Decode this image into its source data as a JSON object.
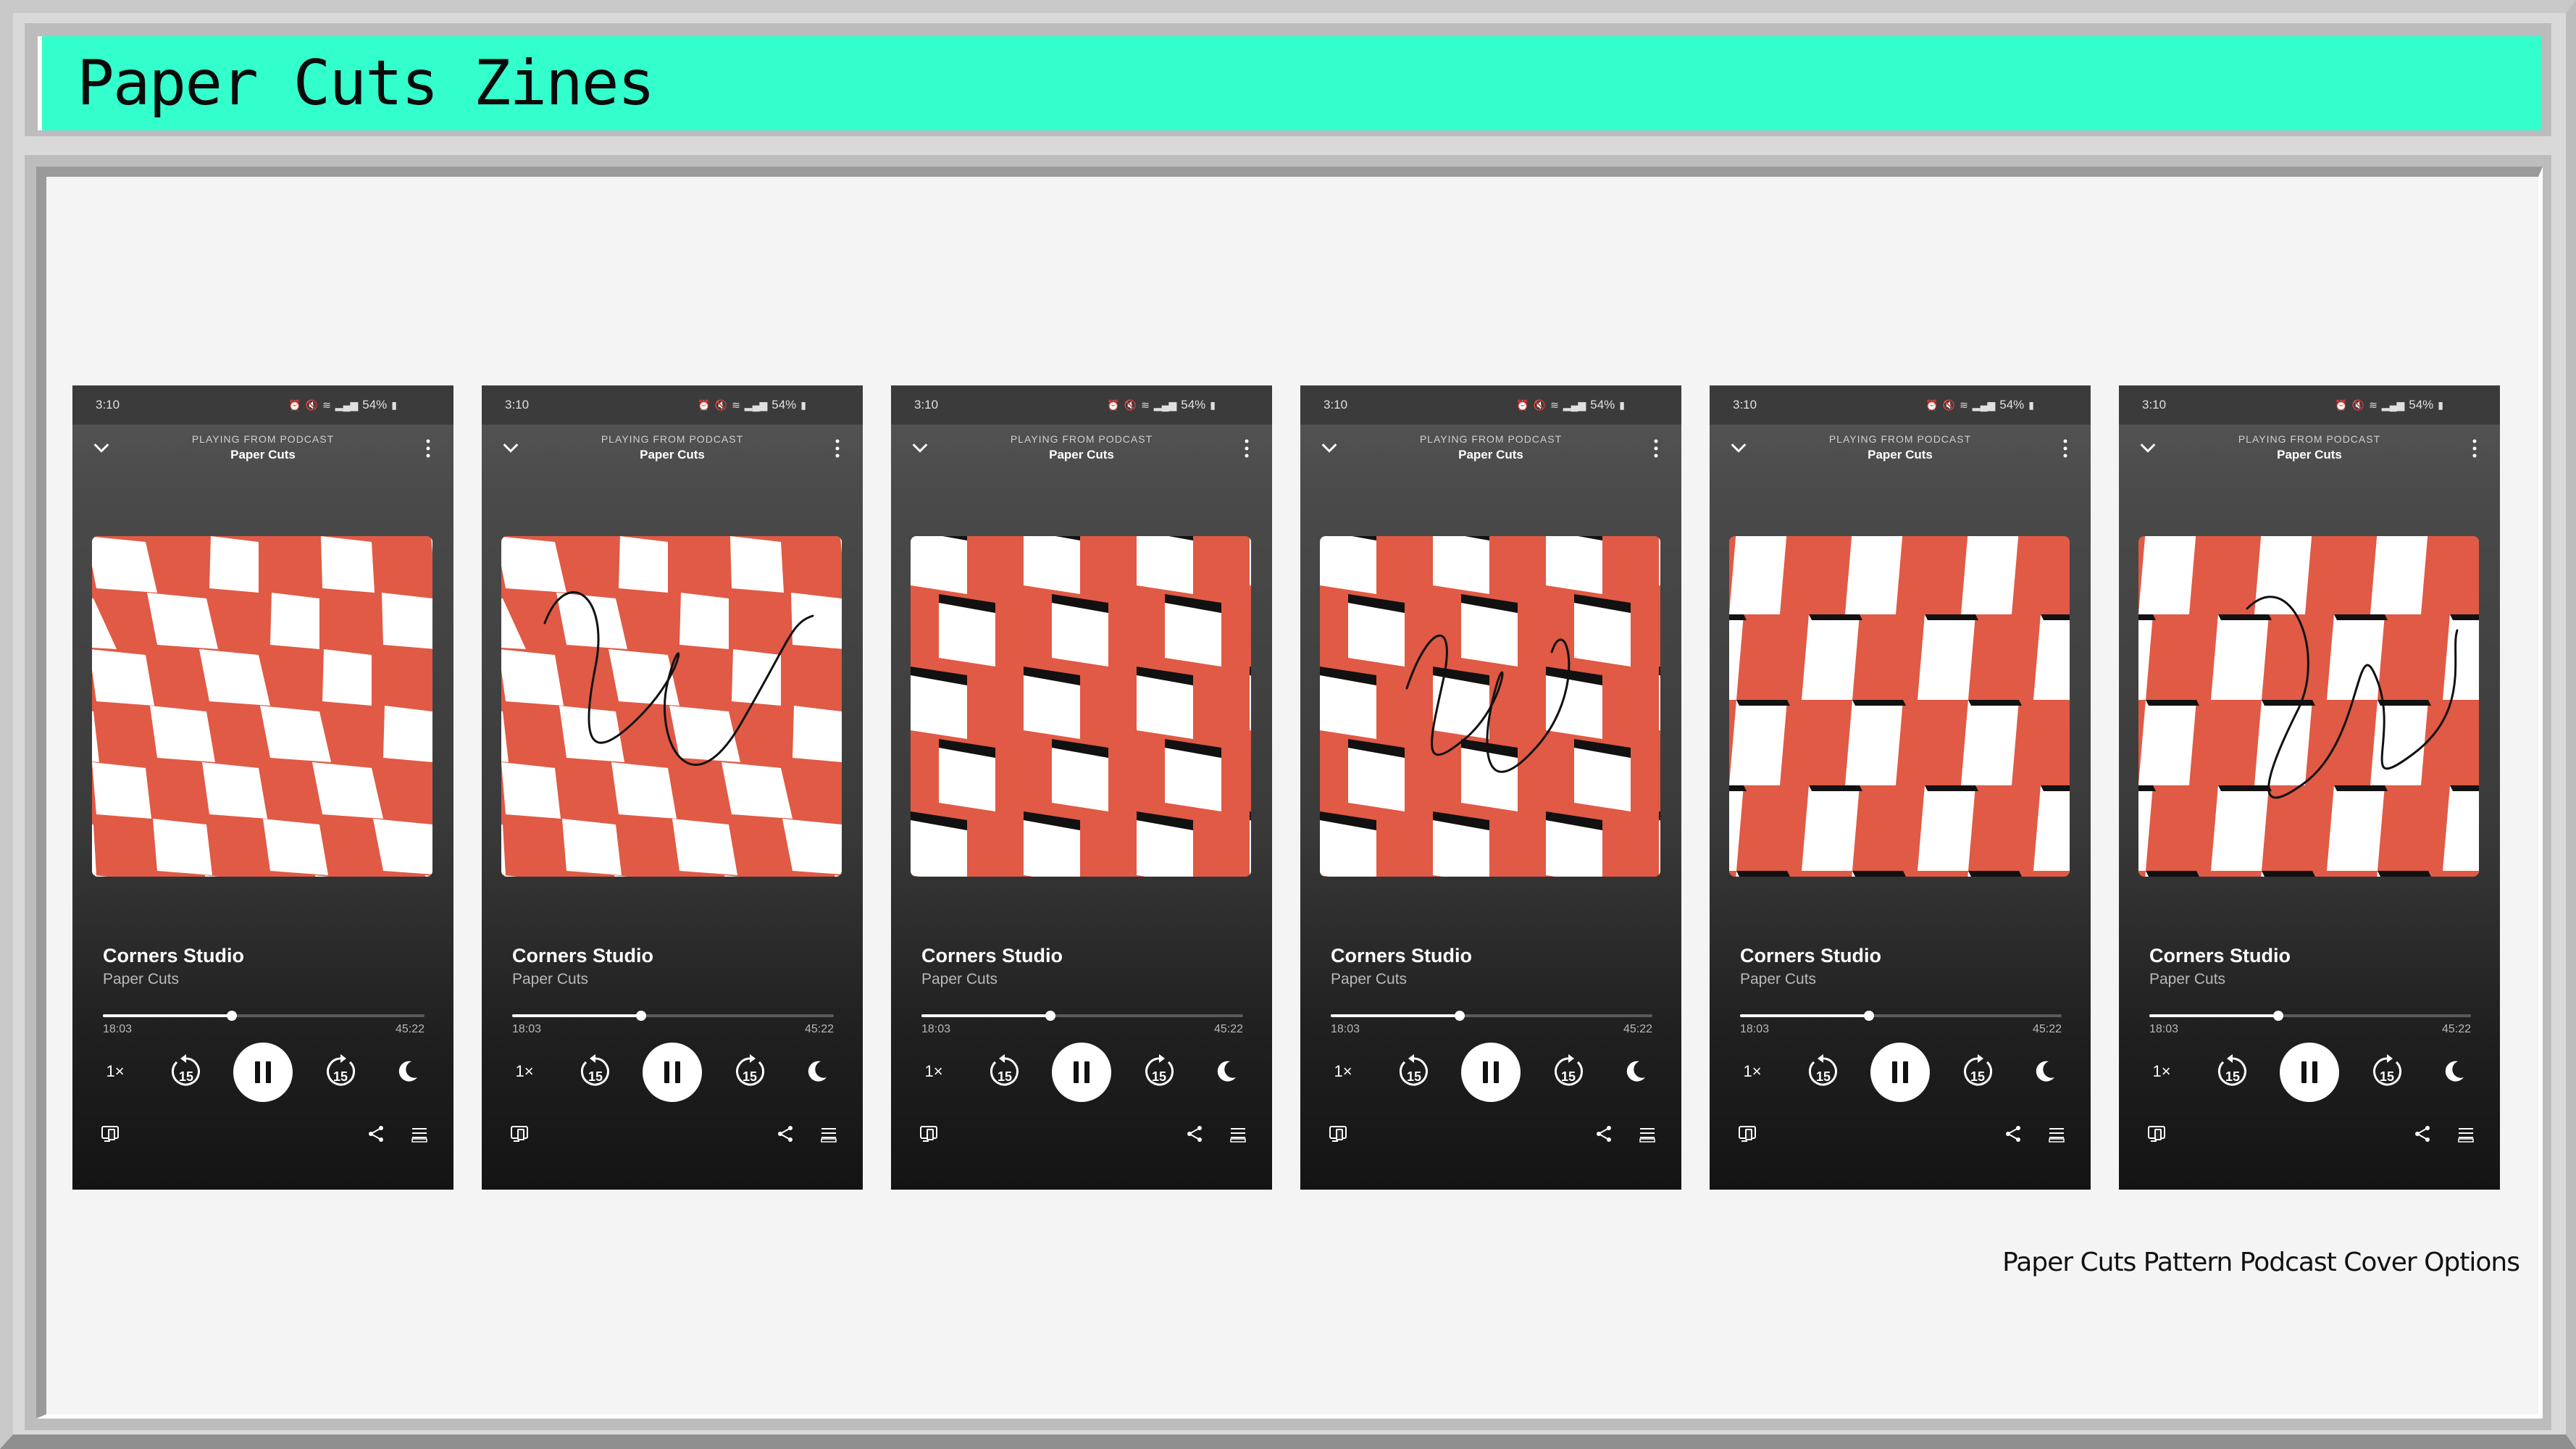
{
  "page": {
    "title": "Paper Cuts Zines",
    "caption": "Paper Cuts Pattern Podcast Cover Options"
  },
  "colors": {
    "title_bar": "#33ffcc",
    "cover_red": "#e05a45",
    "cover_white": "#ffffff",
    "cover_shadow": "#111111"
  },
  "phones": [
    {
      "status": {
        "time": "3:10",
        "battery": "54%"
      },
      "header": {
        "context_label": "PLAYING FROM PODCAST",
        "podcast": "Paper Cuts"
      },
      "cover": {
        "pattern": "tilted-checker",
        "scribble": false
      },
      "track": {
        "title": "Corners Studio",
        "artist": "Paper Cuts"
      },
      "player": {
        "elapsed": "18:03",
        "duration": "45:22",
        "progress": 0.4,
        "speed": "1×",
        "skip_back": "15",
        "skip_forward": "15"
      }
    },
    {
      "status": {
        "time": "3:10",
        "battery": "54%"
      },
      "header": {
        "context_label": "PLAYING FROM PODCAST",
        "podcast": "Paper Cuts"
      },
      "cover": {
        "pattern": "tilted-checker",
        "scribble": true
      },
      "track": {
        "title": "Corners Studio",
        "artist": "Paper Cuts"
      },
      "player": {
        "elapsed": "18:03",
        "duration": "45:22",
        "progress": 0.4,
        "speed": "1×",
        "skip_back": "15",
        "skip_forward": "15"
      }
    },
    {
      "status": {
        "time": "3:10",
        "battery": "54%"
      },
      "header": {
        "context_label": "PLAYING FROM PODCAST",
        "podcast": "Paper Cuts"
      },
      "cover": {
        "pattern": "cube-checker",
        "scribble": false
      },
      "track": {
        "title": "Corners Studio",
        "artist": "Paper Cuts"
      },
      "player": {
        "elapsed": "18:03",
        "duration": "45:22",
        "progress": 0.4,
        "speed": "1×",
        "skip_back": "15",
        "skip_forward": "15"
      }
    },
    {
      "status": {
        "time": "3:10",
        "battery": "54%"
      },
      "header": {
        "context_label": "PLAYING FROM PODCAST",
        "podcast": "Paper Cuts"
      },
      "cover": {
        "pattern": "cube-checker",
        "scribble": true
      },
      "track": {
        "title": "Corners Studio",
        "artist": "Paper Cuts"
      },
      "player": {
        "elapsed": "18:03",
        "duration": "45:22",
        "progress": 0.4,
        "speed": "1×",
        "skip_back": "15",
        "skip_forward": "15"
      }
    },
    {
      "status": {
        "time": "3:10",
        "battery": "54%"
      },
      "header": {
        "context_label": "PLAYING FROM PODCAST",
        "podcast": "Paper Cuts"
      },
      "cover": {
        "pattern": "trapezoid-rows",
        "scribble": false
      },
      "track": {
        "title": "Corners Studio",
        "artist": "Paper Cuts"
      },
      "player": {
        "elapsed": "18:03",
        "duration": "45:22",
        "progress": 0.4,
        "speed": "1×",
        "skip_back": "15",
        "skip_forward": "15"
      }
    },
    {
      "status": {
        "time": "3:10",
        "battery": "54%"
      },
      "header": {
        "context_label": "PLAYING FROM PODCAST",
        "podcast": "Paper Cuts"
      },
      "cover": {
        "pattern": "trapezoid-rows",
        "scribble": true
      },
      "track": {
        "title": "Corners Studio",
        "artist": "Paper Cuts"
      },
      "player": {
        "elapsed": "18:03",
        "duration": "45:22",
        "progress": 0.4,
        "speed": "1×",
        "skip_back": "15",
        "skip_forward": "15"
      }
    }
  ]
}
